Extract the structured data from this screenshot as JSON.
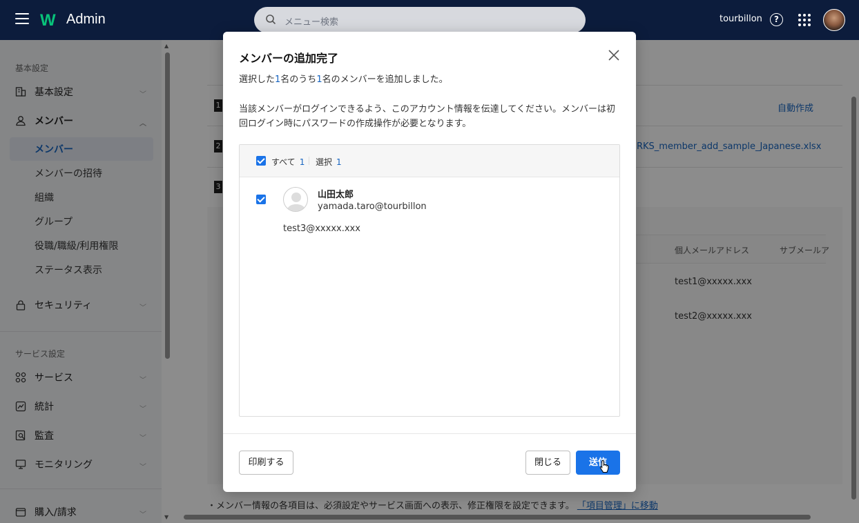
{
  "header": {
    "brand_mark": "W",
    "app_title": "Admin",
    "search_placeholder": "メニュー検索",
    "user_name": "tourbillon",
    "help_label": "?"
  },
  "sidebar": {
    "section_basic": "基本設定",
    "item_basic": "基本設定",
    "item_members": "メンバー",
    "sub_members": "メンバー",
    "sub_invite": "メンバーの招待",
    "sub_org": "組織",
    "sub_group": "グループ",
    "sub_roles": "役職/職級/利用権限",
    "sub_status": "ステータス表示",
    "item_security": "セキュリティ",
    "section_service": "サービス設定",
    "item_service": "サービス",
    "item_stats": "統計",
    "item_audit": "監査",
    "item_monitoring": "モニタリング",
    "item_billing": "購入/請求"
  },
  "background": {
    "step1": "1",
    "step2": "2",
    "step3": "3",
    "auto_create": "自動作成",
    "file_name": "RKS_member_add_sample_Japanese.xlsx",
    "col_personal_mail": "個人メールアドレス",
    "col_sub_mail": "サブメールア",
    "row1_mail": "test1@xxxxx.xxx",
    "row2_mail": "test2@xxxxx.xxx",
    "footer_text": "・メンバー情報の各項目は、必須設定やサービス画面への表示、修正権限を設定できます。",
    "footer_link": "「項目管理」に移動"
  },
  "modal": {
    "title": "メンバーの追加完了",
    "desc_prefix": "選択した",
    "desc_count1": "1",
    "desc_mid": "名のうち",
    "desc_count2": "1",
    "desc_suffix": "名のメンバーを追加しました。",
    "desc_notice": "当該メンバーがログインできるよう、このアカウント情報を伝達してください。メンバーは初回ログイン時にパスワードの作成操作が必要となります。",
    "list_all_label": "すべて",
    "list_all_count": "1",
    "list_selected_label": "選択",
    "list_selected_count": "1",
    "member": {
      "name": "山田太郎",
      "account": "yamada.taro@tourbillon",
      "personal_mail": "test3@xxxxx.xxx"
    },
    "print_button": "印刷する",
    "close_button": "閉じる",
    "send_button": "送信"
  }
}
